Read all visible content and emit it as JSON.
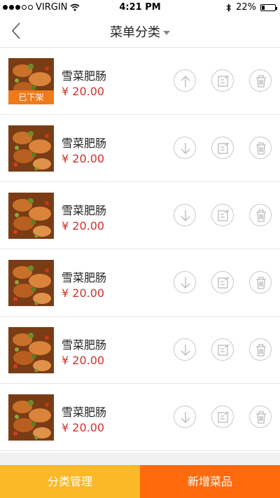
{
  "status_bar": {
    "carrier": "VIRGIN",
    "time": "4:21 PM",
    "battery": "22%"
  },
  "nav": {
    "title": "菜单分类"
  },
  "items": [
    {
      "name": "雪菜肥肠",
      "price": "¥ 20.00",
      "badge": "已下架",
      "toggle_icon": "arrow-up-icon"
    },
    {
      "name": "雪菜肥肠",
      "price": "¥ 20.00",
      "badge": "",
      "toggle_icon": "arrow-down-icon"
    },
    {
      "name": "雪菜肥肠",
      "price": "¥ 20.00",
      "badge": "",
      "toggle_icon": "arrow-down-icon"
    },
    {
      "name": "雪菜肥肠",
      "price": "¥ 20.00",
      "badge": "",
      "toggle_icon": "arrow-down-icon"
    },
    {
      "name": "雪菜肥肠",
      "price": "¥ 20.00",
      "badge": "",
      "toggle_icon": "arrow-down-icon"
    },
    {
      "name": "雪菜肥肠",
      "price": "¥ 20.00",
      "badge": "",
      "toggle_icon": "arrow-down-icon"
    }
  ],
  "bottom": {
    "category_manage": "分类管理",
    "add_dish": "新增菜品"
  },
  "colors": {
    "price": "#d0312d",
    "badge": "#f07a1a",
    "category_button": "#fbb827",
    "add_button": "#ff6a0d"
  }
}
